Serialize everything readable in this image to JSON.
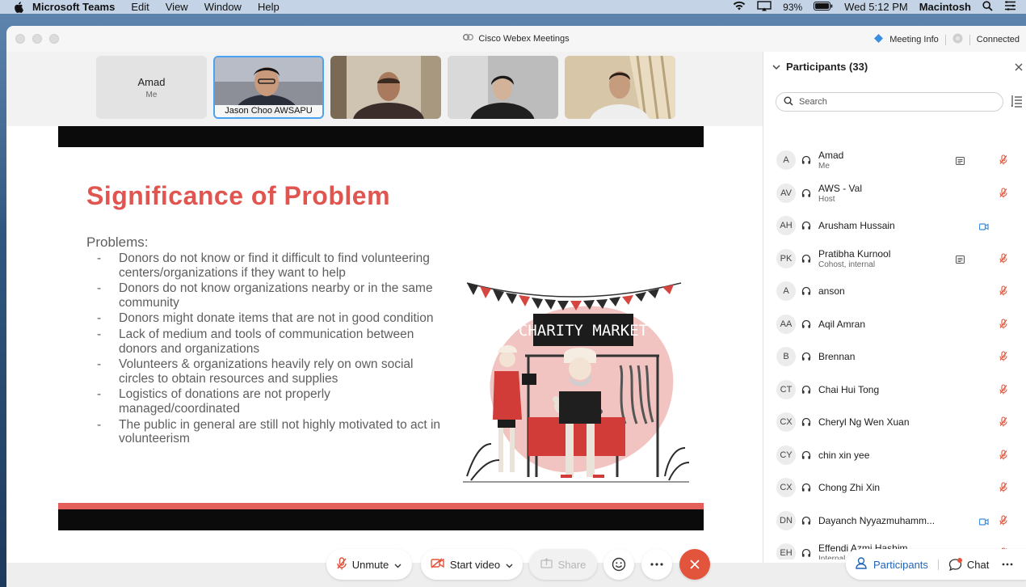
{
  "menubar": {
    "app": "Microsoft Teams",
    "items": [
      "Edit",
      "View",
      "Window",
      "Help"
    ],
    "battery": "93%",
    "clock": "Wed 5:12 PM",
    "user": "Macintosh"
  },
  "window": {
    "title": "Cisco Webex Meetings",
    "meeting_info": "Meeting Info",
    "status": "Connected"
  },
  "thumbnails": {
    "me_name": "Amad",
    "me_sub": "Me",
    "active_caption": "Jason Choo AWSAPU"
  },
  "slide": {
    "title": "Significance of Problem",
    "subtitle": "Problems:",
    "bullets": [
      "Donors do not know or find it difficult to find volunteering centers/organizations if they want to help",
      "Donors do not know organizations nearby or in the same community",
      "Donors might donate items that are not in good condition",
      "Lack of medium and tools of communication between donors and organizations",
      "Volunteers & organizations heavily rely on own social circles to obtain resources and supplies",
      "Logistics of donations are not properly managed/coordinated",
      "The public in general are still not highly motivated to act in volunteerism"
    ],
    "illustration_sign": "CHARITY MARKET"
  },
  "participants": {
    "header": "Participants (33)",
    "search_placeholder": "Search",
    "list": [
      {
        "initials": "A",
        "name": "Amad",
        "role": "Me",
        "icon": "caption-icon",
        "muted": true
      },
      {
        "initials": "AV",
        "name": "AWS - Val",
        "role": "Host",
        "icon": "",
        "muted": true
      },
      {
        "initials": "AH",
        "name": "Arusham Hussain",
        "role": "",
        "icon": "video-icon",
        "muted": false
      },
      {
        "initials": "PK",
        "name": "Pratibha Kurnool",
        "role": "Cohost, internal",
        "icon": "caption-icon",
        "muted": true
      },
      {
        "initials": "A",
        "name": "anson",
        "role": "",
        "icon": "",
        "muted": true
      },
      {
        "initials": "AA",
        "name": "Aqil Amran",
        "role": "",
        "icon": "",
        "muted": true
      },
      {
        "initials": "B",
        "name": "Brennan",
        "role": "",
        "icon": "",
        "muted": true
      },
      {
        "initials": "CT",
        "name": "Chai Hui Tong",
        "role": "",
        "icon": "",
        "muted": true
      },
      {
        "initials": "CX",
        "name": "Cheryl Ng Wen Xuan",
        "role": "",
        "icon": "",
        "muted": true
      },
      {
        "initials": "CY",
        "name": "chin xin yee",
        "role": "",
        "icon": "",
        "muted": true
      },
      {
        "initials": "CX",
        "name": "Chong Zhi Xin",
        "role": "",
        "icon": "",
        "muted": true
      },
      {
        "initials": "DN",
        "name": "Dayanch Nyyazmuhamm...",
        "role": "",
        "icon": "video-icon",
        "muted": true
      },
      {
        "initials": "EH",
        "name": "Effendi Azmi Hashim",
        "role": "Internal",
        "icon": "caption-icon",
        "muted": true
      }
    ]
  },
  "controls": {
    "unmute": "Unmute",
    "start_video": "Start video",
    "share": "Share",
    "participants": "Participants",
    "chat": "Chat"
  },
  "colors": {
    "accent_red": "#e3543d",
    "slide_red": "#e0554f",
    "active_border": "#4aa3f2",
    "link_blue": "#1e64b8"
  }
}
